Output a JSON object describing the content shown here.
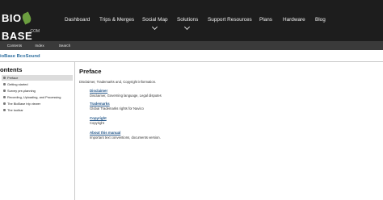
{
  "brand": {
    "name_part1": "BIO",
    "name_part2": "BASE",
    "sub": ".COM"
  },
  "nav": {
    "items": [
      {
        "label": "Dashboard"
      },
      {
        "label": "Trips & Merges"
      },
      {
        "label": "Social Map"
      },
      {
        "label": "Solutions"
      },
      {
        "label": "Support Resources"
      },
      {
        "label": "Plans"
      },
      {
        "label": "Hardware"
      },
      {
        "label": "Blog"
      }
    ]
  },
  "tabs": [
    {
      "label": "Contents"
    },
    {
      "label": "Index"
    },
    {
      "label": "Search"
    }
  ],
  "doc_title": "ioBase BcoSound",
  "sidebar": {
    "heading": "ontents",
    "items": [
      {
        "label": "Preface"
      },
      {
        "label": "Getting started"
      },
      {
        "label": "Survey pre-planning"
      },
      {
        "label": "Recording, Uploading, and Processing"
      },
      {
        "label": "The BioBase trip viewer"
      },
      {
        "label": "The toolbar"
      }
    ]
  },
  "main": {
    "title": "Preface",
    "intro": "Disclaimer, Trademarks and, Copyright information.",
    "sections": [
      {
        "link": "Disclaimer",
        "desc": "Disclaimer, Governing language, Legal disputes"
      },
      {
        "link": "Trademarks",
        "desc": "Global Trademarks rights for Navico"
      },
      {
        "link": "Copyright",
        "desc": "Copyright"
      },
      {
        "link": "About this manual",
        "desc": "Important text conventions, documents version."
      }
    ]
  },
  "colors": {
    "nav_bg": "#1d1d1d",
    "tabbar_bg": "#3a3a3a",
    "link": "#24578a",
    "doc_title": "#2f6f9f",
    "logo_leaf": "#6b9e3f"
  }
}
